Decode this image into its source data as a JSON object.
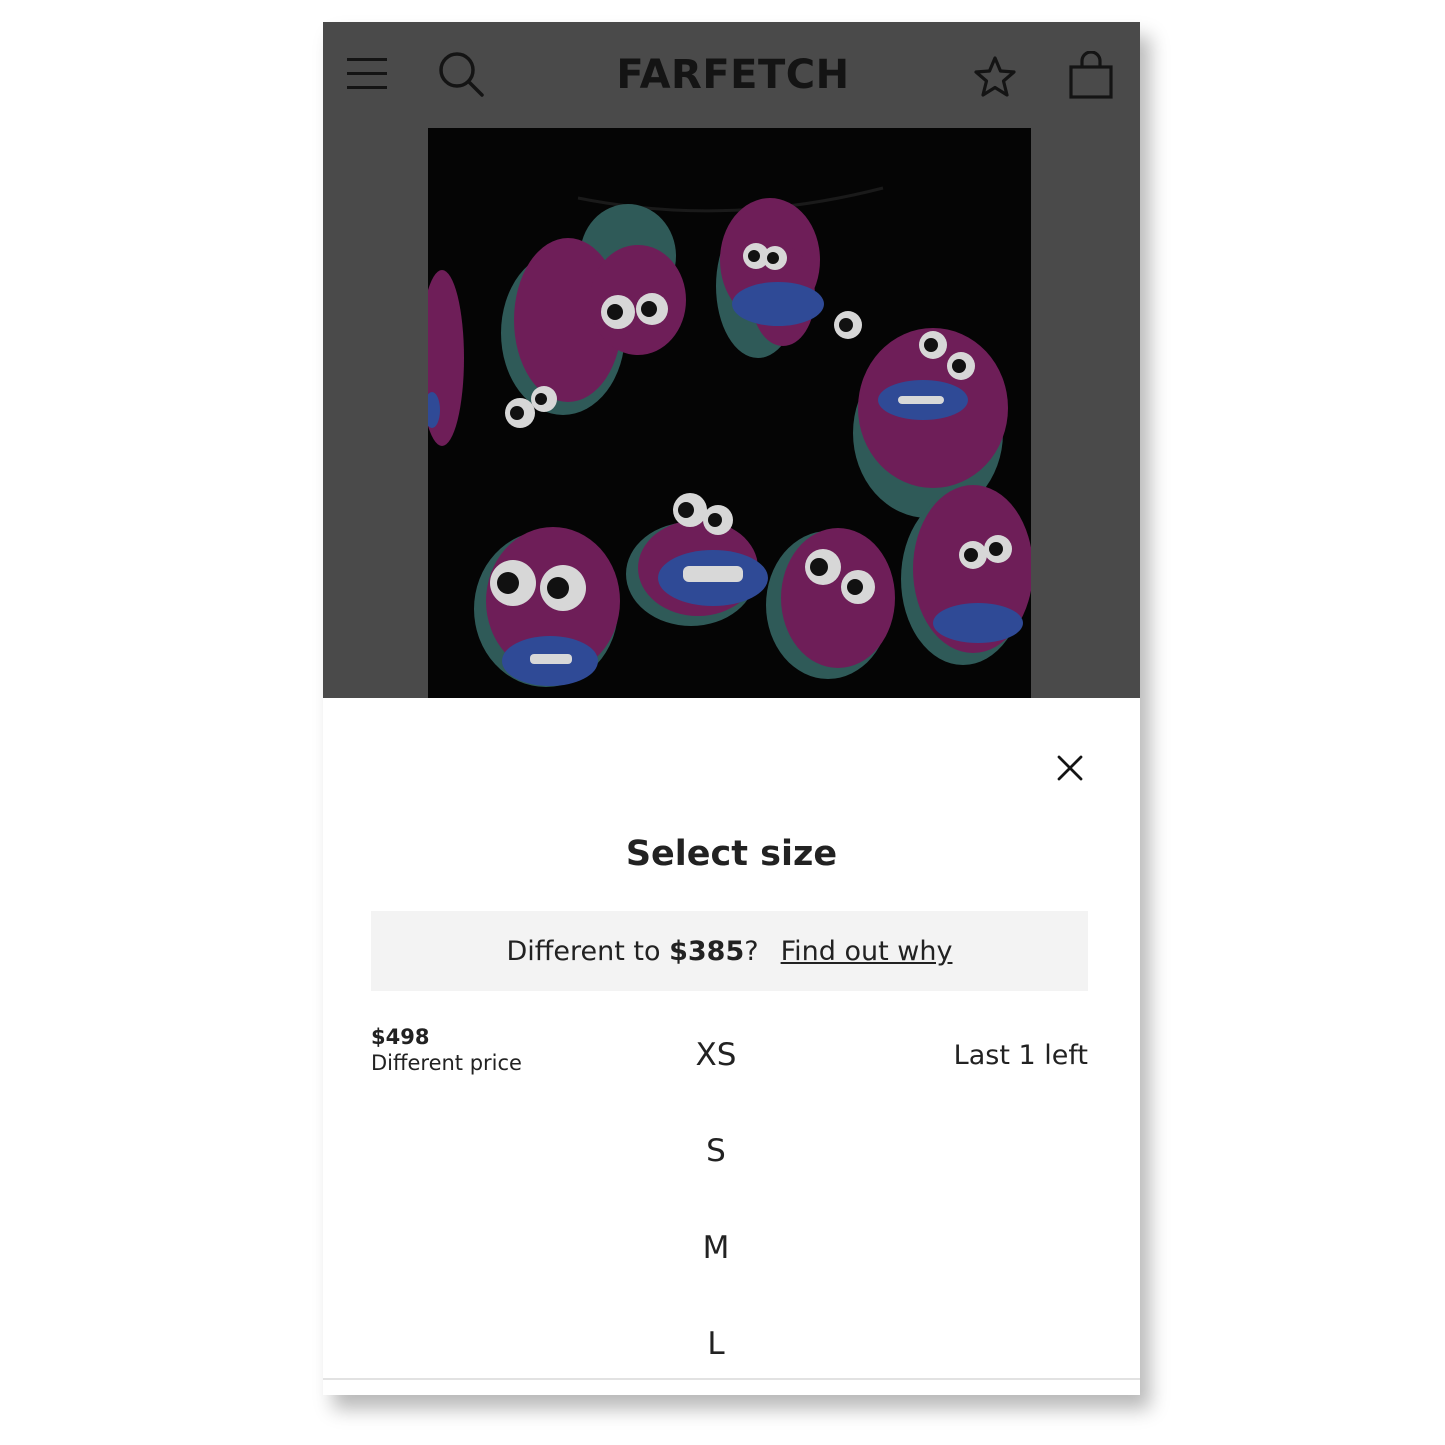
{
  "header": {
    "logo": "FARFETCH",
    "icons": [
      "menu-icon",
      "search-icon",
      "star-icon",
      "bag-icon"
    ]
  },
  "size_sheet": {
    "title": "Select size",
    "notice": {
      "prefix": "Different to ",
      "price": "$385",
      "suffix": "?",
      "link": "Find out why"
    },
    "sizes": [
      {
        "label": "XS",
        "price": "$498",
        "price_note": "Different price",
        "stock": "Last 1 left"
      },
      {
        "label": "S"
      },
      {
        "label": "M"
      },
      {
        "label": "L"
      }
    ]
  },
  "colors": {
    "overlay": "#4a4a4a",
    "text": "#222222",
    "notice_bg": "#f3f3f3"
  }
}
